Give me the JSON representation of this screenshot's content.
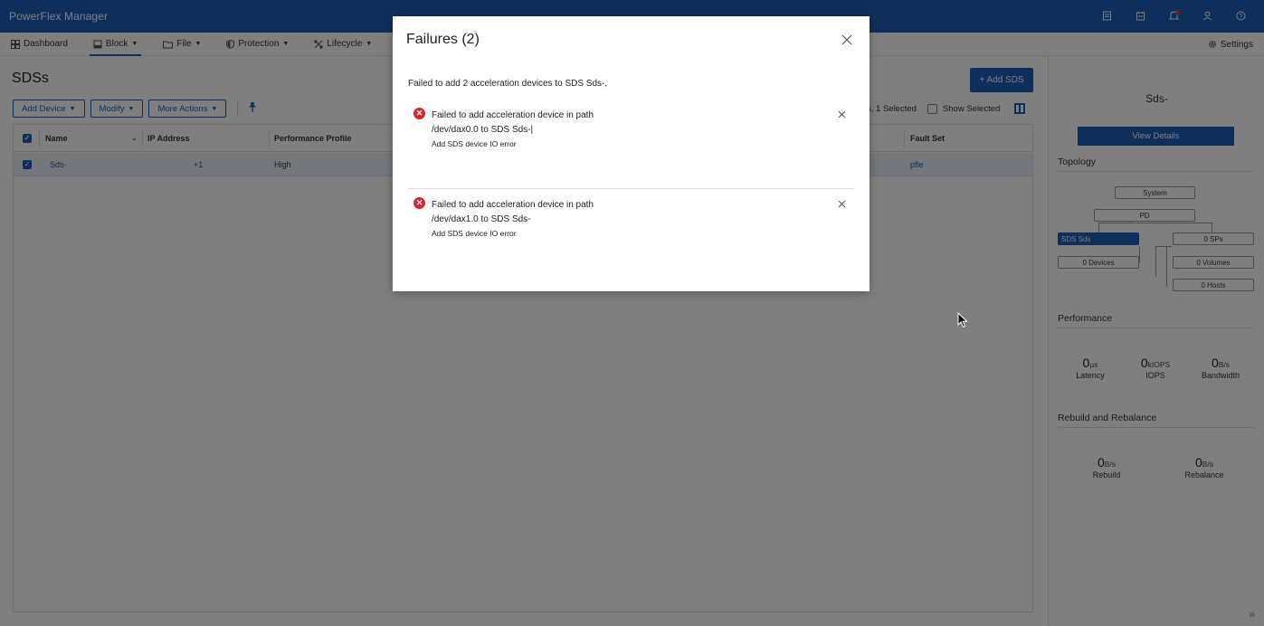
{
  "app": {
    "title": "PowerFlex Manager"
  },
  "nav": {
    "items": [
      {
        "label": "Dashboard",
        "icon": "dashboard-icon",
        "caret": false
      },
      {
        "label": "Block",
        "icon": "block-icon",
        "caret": true
      },
      {
        "label": "File",
        "icon": "folder-icon",
        "caret": true
      },
      {
        "label": "Protection",
        "icon": "shield-icon",
        "caret": true
      },
      {
        "label": "Lifecycle",
        "icon": "lifecycle-icon",
        "caret": true
      }
    ],
    "settings_label": "Settings"
  },
  "page": {
    "title": "SDSs",
    "add_button": "+ Add SDS",
    "toolbar": {
      "add_device": "Add Device",
      "modify": "Modify",
      "more_actions": "More Actions"
    },
    "selection_text": "s, 1 Selected",
    "show_selected": "Show Selected"
  },
  "table": {
    "columns": [
      "Name",
      "IP Address",
      "Performance Profile",
      "Fault Set"
    ],
    "rows": [
      {
        "name": "Sds-",
        "ip": "+1",
        "profile": "High",
        "fault_set": "pfle"
      }
    ]
  },
  "details": {
    "sds_name": "Sds-",
    "view_details": "View Details",
    "topology_title": "Topology",
    "topology": {
      "system": "System",
      "pd": "PD",
      "sds": "SDS Sds",
      "devices": "0 Devices",
      "sps": "0 SPs",
      "volumes": "0 Volumes",
      "hosts": "0 Hosts"
    },
    "performance_title": "Performance",
    "performance": [
      {
        "value": "0",
        "unit": "µs",
        "label": "Latency"
      },
      {
        "value": "0",
        "unit": "kIOPS",
        "label": "IOPS"
      },
      {
        "value": "0",
        "unit": "B/s",
        "label": "Bandwidth"
      }
    ],
    "rebuild_title": "Rebuild and Rebalance",
    "rebuild": [
      {
        "value": "0",
        "unit": "B/s",
        "label": "Rebuild"
      },
      {
        "value": "0",
        "unit": "B/s",
        "label": "Rebalance"
      }
    ]
  },
  "modal": {
    "title": "Failures (2)",
    "summary": "Failed to add 2 acceleration devices to SDS Sds-,",
    "failures": [
      {
        "line1": "Failed to add acceleration device in path",
        "line2": "/dev/dax0.0 to SDS Sds-|",
        "detail": "Add SDS device IO error"
      },
      {
        "line1": "Failed to add acceleration device in path",
        "line2": "/dev/dax1.0 to SDS Sds-",
        "detail": "Add SDS device IO error"
      }
    ]
  },
  "colors": {
    "brand": "#1c5fb8",
    "error": "#d9262e"
  }
}
